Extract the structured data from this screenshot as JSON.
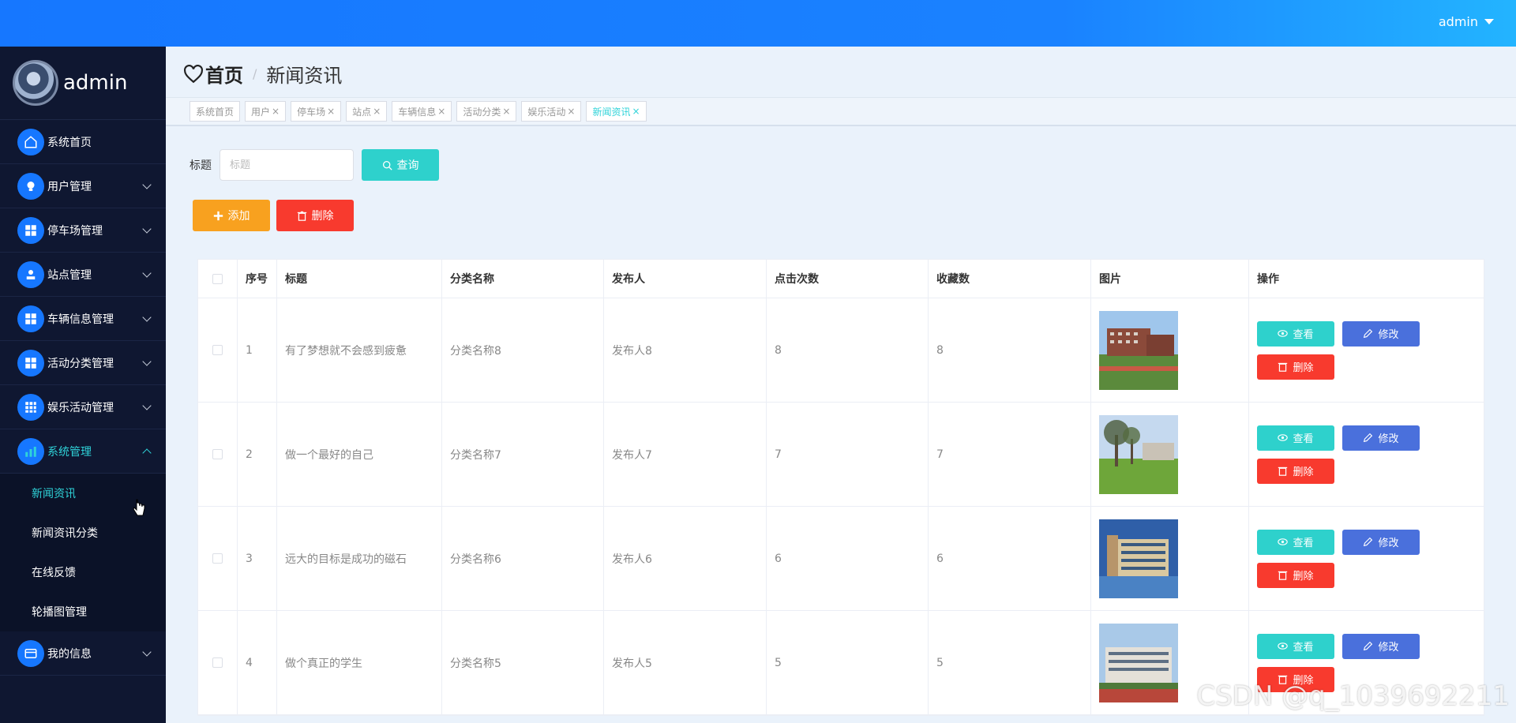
{
  "header": {
    "username": "admin"
  },
  "sidebar": {
    "profile_name": "admin",
    "items": [
      {
        "label": "系统首页",
        "icon": "home-icon",
        "has_arrow": false
      },
      {
        "label": "用户管理",
        "icon": "bulb-icon",
        "has_arrow": true
      },
      {
        "label": "停车场管理",
        "icon": "grid-icon",
        "has_arrow": true
      },
      {
        "label": "站点管理",
        "icon": "user-icon",
        "has_arrow": true
      },
      {
        "label": "车辆信息管理",
        "icon": "grid-icon",
        "has_arrow": true
      },
      {
        "label": "活动分类管理",
        "icon": "grid-icon",
        "has_arrow": true
      },
      {
        "label": "娱乐活动管理",
        "icon": "apps-icon",
        "has_arrow": true
      },
      {
        "label": "系统管理",
        "icon": "chart-icon",
        "has_arrow": true,
        "expanded": true
      }
    ],
    "subitems": [
      "新闻资讯",
      "新闻资讯分类",
      "在线反馈",
      "轮播图管理"
    ],
    "last_item": {
      "label": "我的信息",
      "icon": "wallet-icon"
    }
  },
  "breadcrumb": {
    "home": "首页",
    "separator": "/",
    "current": "新闻资讯"
  },
  "tags": [
    {
      "label": "系统首页",
      "closable": false
    },
    {
      "label": "用户",
      "closable": true
    },
    {
      "label": "停车场",
      "closable": true
    },
    {
      "label": "站点",
      "closable": true
    },
    {
      "label": "车辆信息",
      "closable": true
    },
    {
      "label": "活动分类",
      "closable": true
    },
    {
      "label": "娱乐活动",
      "closable": true
    },
    {
      "label": "新闻资讯",
      "closable": true,
      "active": true
    }
  ],
  "search": {
    "label": "标题",
    "placeholder": "标题",
    "button": "查询"
  },
  "actions": {
    "add": "添加",
    "delete": "删除"
  },
  "table": {
    "headers": [
      "序号",
      "标题",
      "分类名称",
      "发布人",
      "点击次数",
      "收藏数",
      "图片",
      "操作"
    ],
    "rows": [
      {
        "no": "1",
        "title": "有了梦想就不会感到疲惫",
        "category": "分类名称8",
        "publisher": "发布人8",
        "clicks": "8",
        "favorites": "8",
        "image": "campus-building-1"
      },
      {
        "no": "2",
        "title": "做一个最好的自己",
        "category": "分类名称7",
        "publisher": "发布人7",
        "clicks": "7",
        "favorites": "7",
        "image": "campus-trees-2"
      },
      {
        "no": "3",
        "title": "远大的目标是成功的磁石",
        "category": "分类名称6",
        "publisher": "发布人6",
        "clicks": "6",
        "favorites": "6",
        "image": "campus-building-3"
      },
      {
        "no": "4",
        "title": "做个真正的学生",
        "category": "分类名称5",
        "publisher": "发布人5",
        "clicks": "5",
        "favorites": "5",
        "image": "campus-track-4"
      }
    ],
    "row_buttons": {
      "view": "查看",
      "edit": "修改",
      "remove": "删除"
    }
  },
  "watermark": "CSDN @q_1039692211",
  "colors": {
    "topbar": "#1677ff",
    "sidebar": "#0f1731",
    "accent": "#2ed1cc",
    "add": "#f8a11f",
    "danger": "#f83a2e",
    "edit": "#4a70dc"
  }
}
